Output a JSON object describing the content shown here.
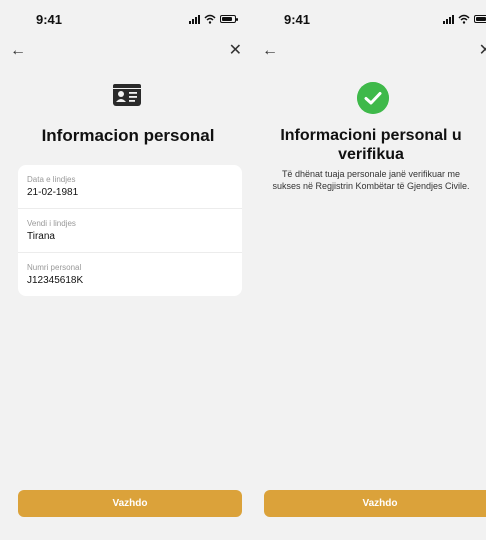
{
  "colors": {
    "accent": "#DBA23A",
    "success": "#3FB94A",
    "background": "#F2F2F2",
    "card": "#FFFFFF"
  },
  "left_screen": {
    "status": {
      "time": "9:41"
    },
    "nav": {
      "back_icon": "arrow-left-icon",
      "close_icon": "close-icon"
    },
    "header_icon": "id-card-icon",
    "title": "Informacion personal",
    "fields": [
      {
        "label": "Data e lindjes",
        "value": "21-02-1981"
      },
      {
        "label": "Vendi i lindjes",
        "value": "Tirana"
      },
      {
        "label": "Numri personal",
        "value": "J12345618K"
      }
    ],
    "button_label": "Vazhdo"
  },
  "right_screen": {
    "status": {
      "time": "9:41"
    },
    "nav": {
      "back_icon": "arrow-left-icon",
      "close_icon": "close-icon"
    },
    "header_icon": "checkmark-icon",
    "title_line1": "Informacioni personal u",
    "title_line2": "verifikua",
    "description_line1": "Të dhënat tuaja personale janë verifikuar me",
    "description_line2": "sukses në Regjistrin Kombëtar të Gjendjes Civile.",
    "button_label": "Vazhdo"
  }
}
